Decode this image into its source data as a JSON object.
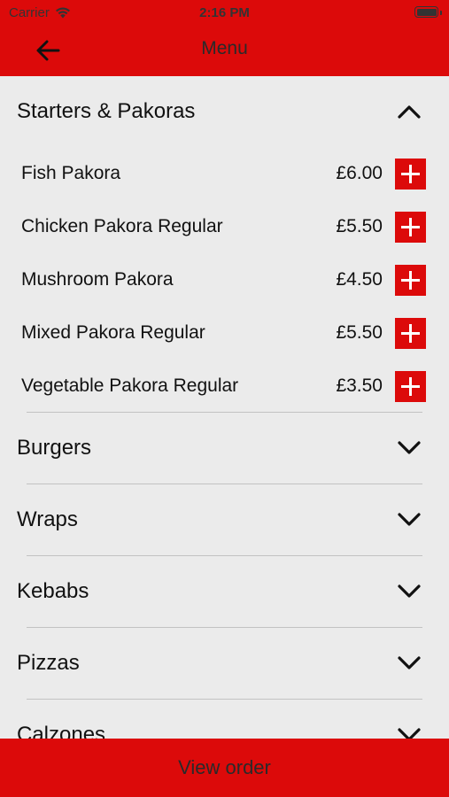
{
  "status_bar": {
    "carrier": "Carrier",
    "time": "2:16 PM"
  },
  "nav": {
    "title": "Menu",
    "back_icon": "arrow-left-icon"
  },
  "colors": {
    "brand_red": "#dc0a0a",
    "background": "#ebebeb",
    "divider": "#c2c2c2"
  },
  "sections": [
    {
      "title": "Starters & Pakoras",
      "expanded": true,
      "items": [
        {
          "name": "Fish Pakora",
          "price": "£6.00"
        },
        {
          "name": "Chicken Pakora Regular",
          "price": "£5.50"
        },
        {
          "name": "Mushroom Pakora",
          "price": "£4.50"
        },
        {
          "name": "Mixed Pakora Regular",
          "price": "£5.50"
        },
        {
          "name": "Vegetable Pakora Regular",
          "price": "£3.50"
        }
      ]
    },
    {
      "title": "Burgers",
      "expanded": false
    },
    {
      "title": "Wraps",
      "expanded": false
    },
    {
      "title": "Kebabs",
      "expanded": false
    },
    {
      "title": "Pizzas",
      "expanded": false
    },
    {
      "title": "Calzones",
      "expanded": false
    }
  ],
  "footer": {
    "view_order_label": "View order"
  }
}
